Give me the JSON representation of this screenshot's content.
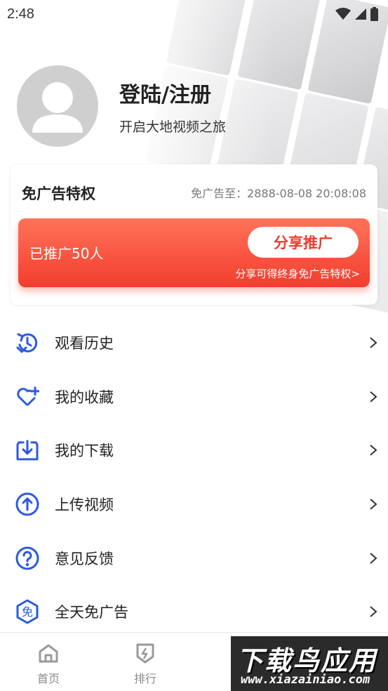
{
  "status_bar": {
    "time": "2:48"
  },
  "profile": {
    "title": "登陆/注册",
    "subtitle": "开启大地视频之旅"
  },
  "ad_card": {
    "title": "免广告特权",
    "expire_text": "免广告至：2888-08-08 20:08:08",
    "promo_count": "已推广50人",
    "share_button": "分享推广",
    "promo_note": "分享可得终身免广告特权>"
  },
  "menu": [
    {
      "label": "观看历史",
      "icon": "history-icon"
    },
    {
      "label": "我的收藏",
      "icon": "favorite-heart-icon"
    },
    {
      "label": "我的下载",
      "icon": "download-icon"
    },
    {
      "label": "上传视频",
      "icon": "upload-icon"
    },
    {
      "label": "意见反馈",
      "icon": "feedback-question-icon"
    },
    {
      "label": "全天免广告",
      "icon": "no-ads-icon"
    }
  ],
  "bottom_nav": [
    {
      "label": "首页",
      "icon": "home-icon"
    },
    {
      "label": "排行",
      "icon": "ranking-icon"
    }
  ],
  "watermark": {
    "main": "下载鸟应用",
    "sub": "www.xiazainiao.com"
  },
  "colors": {
    "accent_blue": "#2b59e0",
    "promo_red": "#f33d2e",
    "share_text": "#ef3b2f"
  }
}
